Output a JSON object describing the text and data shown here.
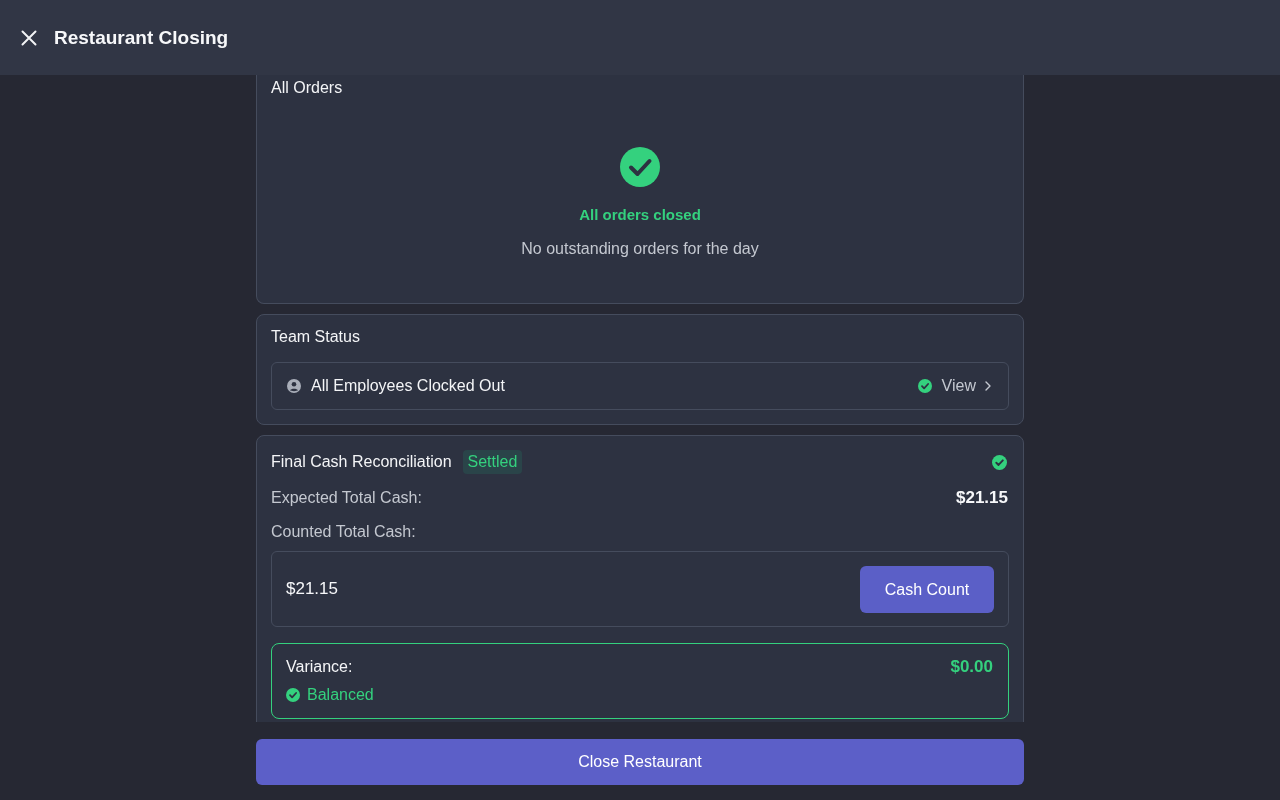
{
  "header": {
    "title": "Restaurant Closing"
  },
  "orders": {
    "title": "All Orders",
    "all_closed": true,
    "heading": "All orders closed",
    "message": "No outstanding orders for the day"
  },
  "team_status": {
    "title": "Team Status",
    "row": {
      "label": "All Employees Clocked Out",
      "done": true,
      "link": "View"
    }
  },
  "cash_reconciliation": {
    "title": "Final Cash Reconciliation",
    "badge": "Settled",
    "settled": true,
    "expected_label": "Expected Total Cash:",
    "expected_value": "$21.15",
    "counted_label": "Counted Total Cash:",
    "counted_value": "$21.15",
    "count_button": "Cash Count",
    "variance": {
      "label": "Variance:",
      "value": "$0.00",
      "status": "Balanced",
      "balanced": true
    }
  },
  "primary_button": "Close Restaurant"
}
